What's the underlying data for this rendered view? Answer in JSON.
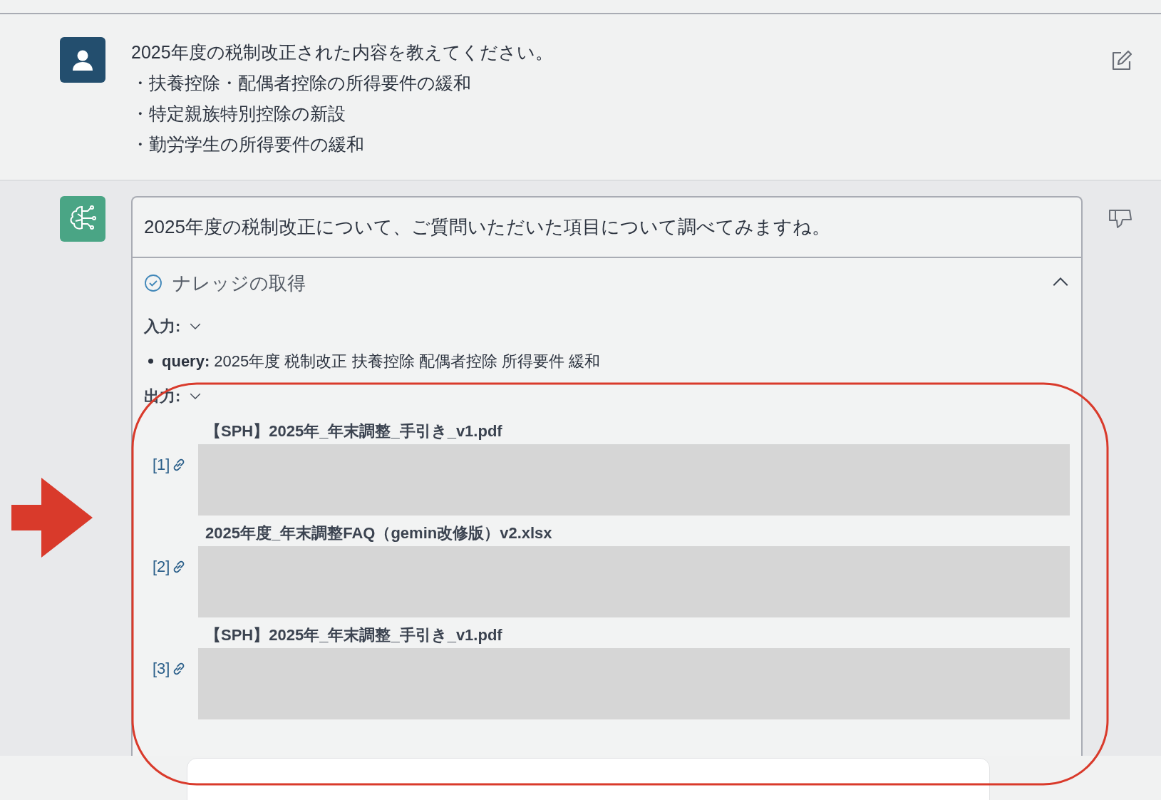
{
  "user_message": {
    "lines": [
      "2025年度の税制改正された内容を教えてください。",
      "・扶養控除・配偶者控除の所得要件の緩和",
      "・特定親族特別控除の新設",
      "・勤労学生の所得要件の緩和"
    ]
  },
  "assistant_message": {
    "text": "2025年度の税制改正について、ご質問いただいた項目について調べてみますね。",
    "tool_call": {
      "title": "ナレッジの取得",
      "done": true,
      "expanded": true,
      "input": {
        "label": "入力:",
        "expanded": true,
        "params": [
          {
            "key": "query:",
            "value": "2025年度 税制改正 扶養控除 配偶者控除 所得要件 緩和"
          }
        ]
      },
      "output": {
        "label": "出力:",
        "expanded": true,
        "results": [
          {
            "ref": "[1]",
            "title": "【SPH】2025年_年末調整_手引き_v1.pdf",
            "redacted": true
          },
          {
            "ref": "[2]",
            "title": "2025年度_年末調整FAQ（gemin改修版）v2.xlsx",
            "redacted": true
          },
          {
            "ref": "[3]",
            "title": "【SPH】2025年_年末調整_手引き_v1.pdf",
            "redacted": true
          }
        ]
      }
    }
  },
  "annotations": {
    "arrow": true,
    "circle": true
  }
}
